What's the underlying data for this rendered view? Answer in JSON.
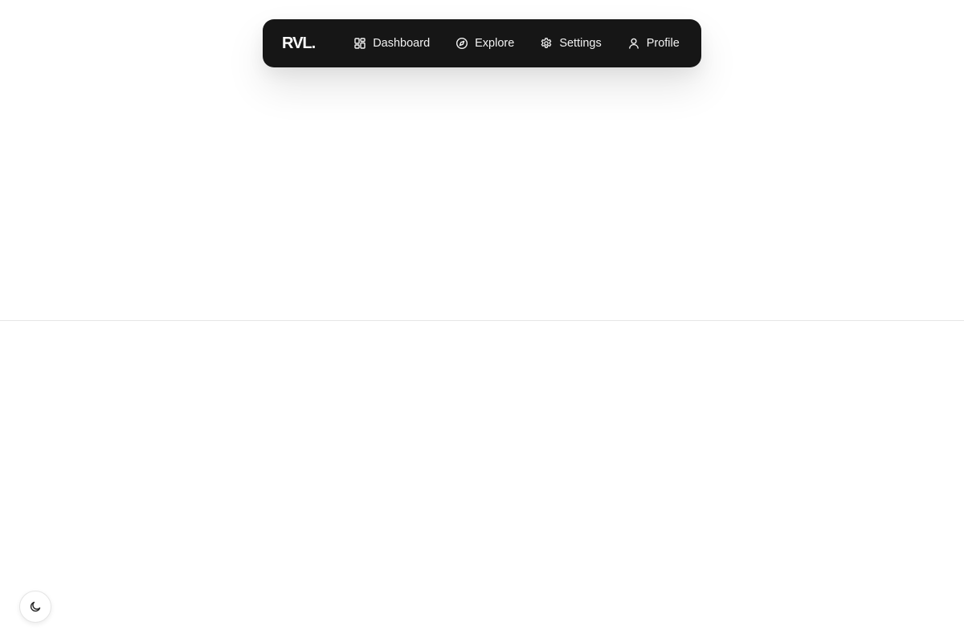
{
  "navbar": {
    "logo": "RVL.",
    "items": [
      {
        "label": "Dashboard",
        "icon": "dashboard-icon"
      },
      {
        "label": "Explore",
        "icon": "compass-icon"
      },
      {
        "label": "Settings",
        "icon": "gear-icon"
      },
      {
        "label": "Profile",
        "icon": "user-icon"
      }
    ]
  },
  "theme_toggle": {
    "icon": "moon-icon"
  },
  "colors": {
    "navbar_bg": "#161616",
    "nav_text": "#f2f2f2",
    "page_bg": "#ffffff"
  }
}
